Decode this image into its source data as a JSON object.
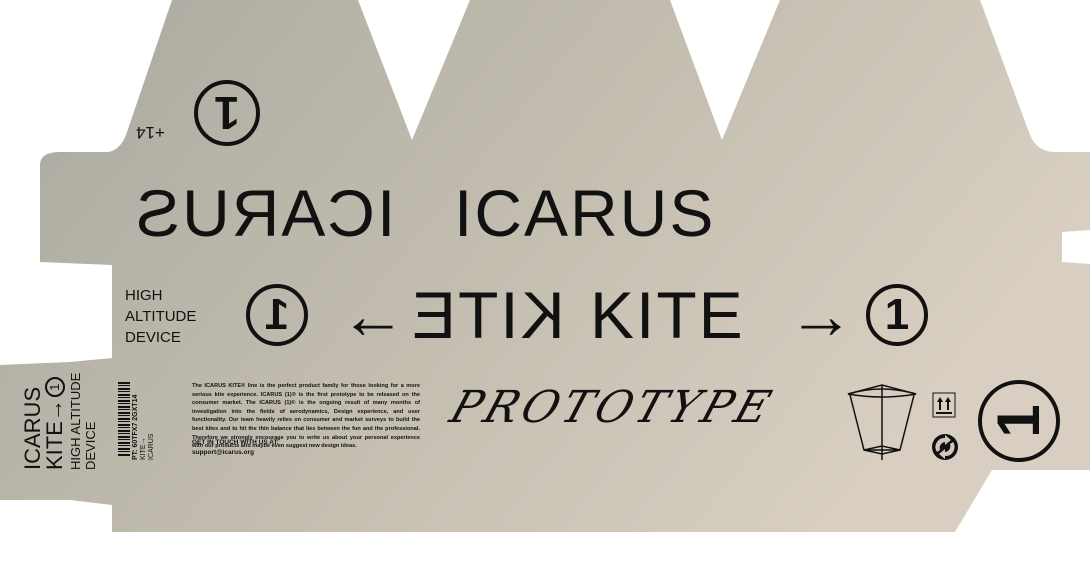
{
  "colors": {
    "panel_start": "#a7a79d",
    "panel_end": "#d6cdbf",
    "ink": "#111111"
  },
  "top": {
    "age_label": "+14",
    "badge": "1"
  },
  "headline": {
    "mirrored": "ICARUS",
    "normal": "ICARUS"
  },
  "tagline": [
    "HIGH",
    "ALTITUDE",
    "DEVICE"
  ],
  "kite_row": {
    "badge_left": "1",
    "mirrored": "KITE",
    "arrow_left": "←",
    "normal": "KITE",
    "arrow_right": "→",
    "badge_right": "1"
  },
  "side_panel": {
    "brand": "ICARUS",
    "product": "KITE→",
    "badge": "1",
    "line1": "HIGH ALTITUDE",
    "line2": "DEVICE"
  },
  "barcode_panel": {
    "brand": "ICARUS",
    "product": "KITE→",
    "code": "PT: 60TFX7 2GXT14"
  },
  "description": "The ICARUS KITE® line is the perfect product family for those looking for a more serious kite experience. ICARUS (1)® is the first prototype to be released on the consumer market. The ICARUS (1)® is the ongoing result of many months of investigation into the fields of aerodynamics, Design experience, and user functionality. Our team heavily relies on consumer and market surveys to build the best kites and to hit the thin balance that lies between the fun and the professional. Therefore we strongly encourage you to write us about your personal experience with our products and maybe even suggest new design ideas.",
  "contact": {
    "heading": "GET IN TOUCH WITH US AT:",
    "email": "support@icarus.org"
  },
  "script_word": "PROTOTYPE",
  "icons": [
    "kite-icon",
    "this-way-up-icon",
    "green-dot-recycle-icon"
  ],
  "end_badge": "1"
}
